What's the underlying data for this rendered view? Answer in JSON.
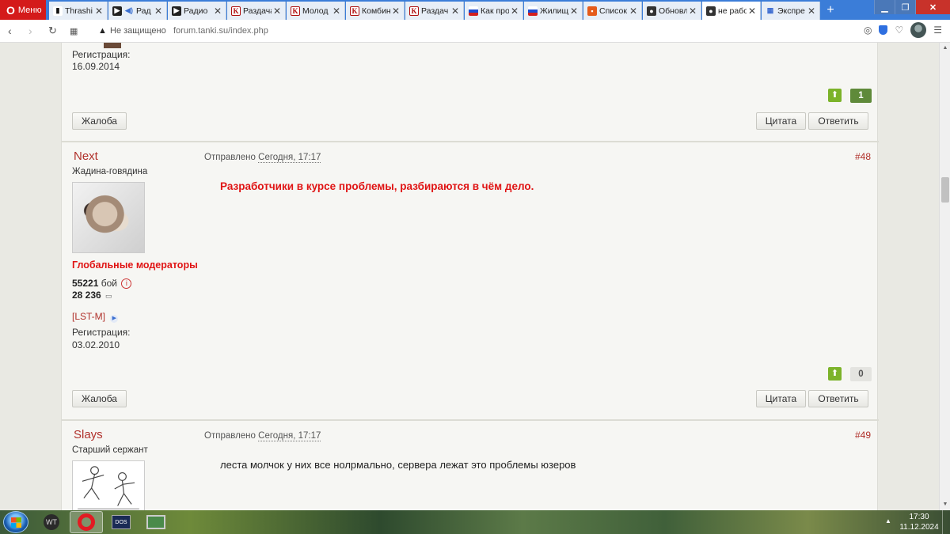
{
  "browser": {
    "menu_label": "Меню",
    "tabs": [
      {
        "title": "Thrashi",
        "icon": "bars-icon"
      },
      {
        "title": "Рад",
        "icon": "play-icon"
      },
      {
        "title": "Радио",
        "icon": "play-icon"
      },
      {
        "title": "Раздача",
        "icon": "k-icon"
      },
      {
        "title": "Молод",
        "icon": "k-icon"
      },
      {
        "title": "Комбин",
        "icon": "k-icon"
      },
      {
        "title": "Раздач",
        "icon": "k-icon"
      },
      {
        "title": "Как про",
        "icon": "flag-icon"
      },
      {
        "title": "Жилищ",
        "icon": "flag-icon"
      },
      {
        "title": "Список",
        "icon": "doc-icon"
      },
      {
        "title": "Обновл",
        "icon": "tank-icon"
      },
      {
        "title": "не рабо",
        "icon": "tank-icon"
      },
      {
        "title": "Экспре",
        "icon": "grid-icon"
      }
    ],
    "address": {
      "security_label": "Не защищено",
      "url": "forum.tanki.su/index.php"
    }
  },
  "top_post": {
    "reg_label": "Регистрация:",
    "reg_date": "16.09.2014",
    "rep_value": "1",
    "complain": "Жалоба",
    "quote": "Цитата",
    "reply": "Ответить"
  },
  "post48": {
    "author": "Next",
    "title": "Жадина-говядина",
    "group": "Глобальные модераторы",
    "battles": "55221",
    "battles_label": "бой",
    "posts": "28 236",
    "clan": "[LST-M]",
    "reg_label": "Регистрация:",
    "reg_date": "03.02.2010",
    "sent_label": "Отправлено",
    "sent_time": "Сегодня, 17:17",
    "number": "#48",
    "body": "Разработчики в курсе проблемы, разбираются в чём дело.",
    "rep_value": "0",
    "complain": "Жалоба",
    "quote": "Цитата",
    "reply": "Ответить"
  },
  "post49": {
    "author": "Slays",
    "title": "Старший сержант",
    "sent_label": "Отправлено",
    "sent_time": "Сегодня, 17:17",
    "number": "#49",
    "body": "леста молчок у них все нолрмально, сервера лежат это проблемы юзеров"
  },
  "taskbar": {
    "time": "17:30",
    "date": "11.12.2024",
    "dos_label": "DOS"
  },
  "colors": {
    "accent_red": "#e01414",
    "author_red": "#b0302a",
    "rep_green": "#7cb32a"
  }
}
